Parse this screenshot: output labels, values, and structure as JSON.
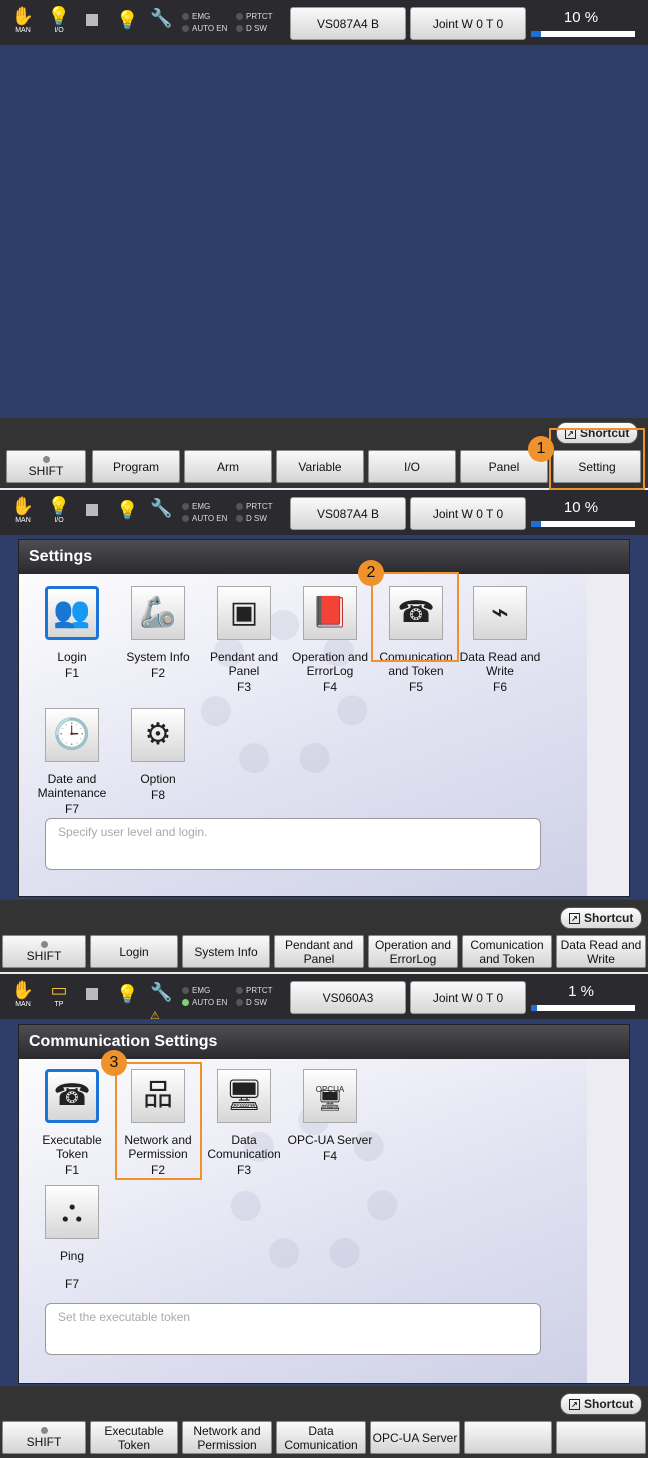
{
  "statusbar": {
    "mode_label": "MAN",
    "io_label": "I/O",
    "tp_label": "TP",
    "emg": "EMG",
    "prtct": "PRTCT",
    "auto_en": "AUTO EN",
    "d_sw": "D SW",
    "robot_a": "VS087A4 B",
    "robot_b": "VS060A3",
    "joint": "Joint  W 0 T 0",
    "speed_a": "10 %",
    "speed_b": "1 %",
    "speed_a_level": 0.1,
    "speed_b_level": 0.01
  },
  "icons": {
    "hand": "hand-icon",
    "io": "io-bulb-icon",
    "bulb": "light-bulb-icon",
    "wrench": "wrench-icon",
    "warning": "warning-icon"
  },
  "shortcut_label": "Shortcut",
  "main_menu": {
    "shift": "SHIFT",
    "keys": [
      "Program",
      "Arm",
      "Variable",
      "I/O",
      "Panel",
      "Setting"
    ]
  },
  "settings": {
    "title": "Settings",
    "tiles": [
      {
        "label": "Login",
        "fkey": "F1",
        "icon": "user-icon"
      },
      {
        "label": "System Info",
        "fkey": "F2",
        "icon": "robot-arm-icon"
      },
      {
        "label": "Pendant and Panel",
        "fkey": "F3",
        "icon": "pendant-icon"
      },
      {
        "label": "Operation and ErrorLog",
        "fkey": "F4",
        "icon": "book-icon"
      },
      {
        "label": "Comunication and Token",
        "fkey": "F5",
        "icon": "phone-icon"
      },
      {
        "label": "Data Read and Write",
        "fkey": "F6",
        "icon": "usb-icon"
      },
      {
        "label": "Date and Maintenance",
        "fkey": "F7",
        "icon": "clock-calendar-icon"
      },
      {
        "label": "Option",
        "fkey": "F8",
        "icon": "gears-icon"
      }
    ],
    "message": "Specify user level and login.",
    "fkeys": [
      "SHIFT",
      "Login",
      "System Info",
      "Pendant and Panel",
      "Operation and ErrorLog",
      "Comunication and Token",
      "Data Read and Write"
    ]
  },
  "comm": {
    "title": "Communication Settings",
    "tiles": [
      {
        "label": "Executable Token",
        "fkey": "F1",
        "icon": "token-phone-icon"
      },
      {
        "label": "Network and Permission",
        "fkey": "F2",
        "icon": "network-icon"
      },
      {
        "label": "Data Comunication",
        "fkey": "F3",
        "icon": "data-comm-icon"
      },
      {
        "label": "OPC-UA Server",
        "fkey": "F4",
        "icon": "opcua-monitor-icon"
      },
      {
        "label": "Ping",
        "fkey": "F7",
        "icon": "ping-icon"
      }
    ],
    "opcua_caption": "OPCUA",
    "message": "Set the executable token",
    "fkeys": [
      "SHIFT",
      "Executable Token",
      "Network and Permission",
      "Data Comunication",
      "OPC-UA Server",
      "",
      ""
    ]
  },
  "callouts": [
    "1",
    "2",
    "3"
  ],
  "colors": {
    "accent": "#f0922b",
    "selection": "#1c75d6",
    "background": "#2f3d6a"
  }
}
